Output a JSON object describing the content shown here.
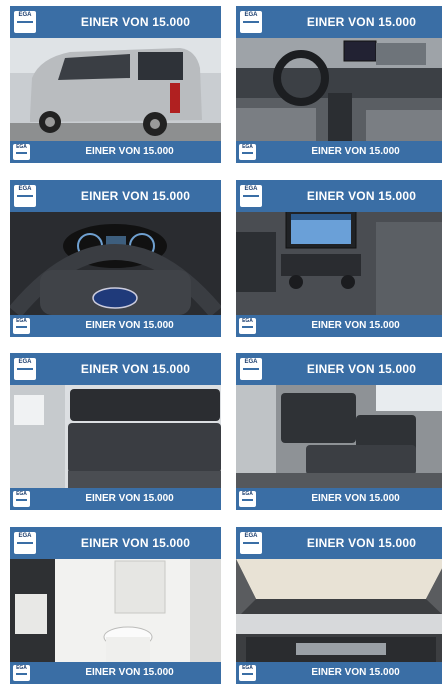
{
  "tiles": [
    {
      "banner": "EINER VON 15.000",
      "footer": "EINER VON 15.000",
      "logo": "EGA",
      "photo": "van-exterior-rear"
    },
    {
      "banner": "EINER VON 15.000",
      "footer": "EINER VON 15.000",
      "logo": "EGA",
      "photo": "cockpit-dashboard"
    },
    {
      "banner": "EINER VON 15.000",
      "footer": "EINER VON 15.000",
      "logo": "EGA",
      "photo": "steering-wheel-instruments"
    },
    {
      "banner": "EINER VON 15.000",
      "footer": "EINER VON 15.000",
      "logo": "EGA",
      "photo": "infotainment-screen"
    },
    {
      "banner": "EINER VON 15.000",
      "footer": "EINER VON 15.000",
      "logo": "EGA",
      "photo": "rear-bench-seat"
    },
    {
      "banner": "EINER VON 15.000",
      "footer": "EINER VON 15.000",
      "logo": "EGA",
      "photo": "interior-side-seating"
    },
    {
      "banner": "EINER VON 15.000",
      "footer": "EINER VON 15.000",
      "logo": "EGA",
      "photo": "bathroom-toilet"
    },
    {
      "banner": "EINER VON 15.000",
      "footer": "EINER VON 15.000",
      "logo": "EGA",
      "photo": "pop-up-roof-bed"
    }
  ],
  "colors": {
    "brand": "#3a6ea5",
    "text": "#ffffff"
  }
}
